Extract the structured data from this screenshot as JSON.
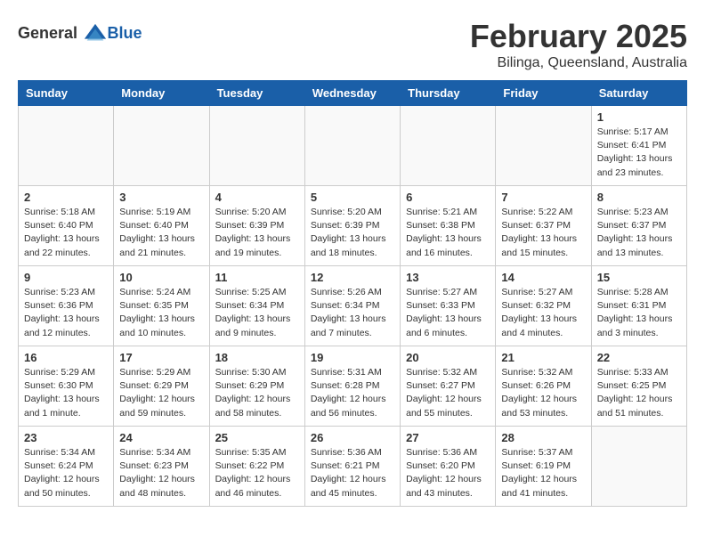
{
  "header": {
    "logo_general": "General",
    "logo_blue": "Blue",
    "month_year": "February 2025",
    "location": "Bilinga, Queensland, Australia"
  },
  "weekdays": [
    "Sunday",
    "Monday",
    "Tuesday",
    "Wednesday",
    "Thursday",
    "Friday",
    "Saturday"
  ],
  "weeks": [
    [
      {
        "day": "",
        "info": ""
      },
      {
        "day": "",
        "info": ""
      },
      {
        "day": "",
        "info": ""
      },
      {
        "day": "",
        "info": ""
      },
      {
        "day": "",
        "info": ""
      },
      {
        "day": "",
        "info": ""
      },
      {
        "day": "1",
        "info": "Sunrise: 5:17 AM\nSunset: 6:41 PM\nDaylight: 13 hours\nand 23 minutes."
      }
    ],
    [
      {
        "day": "2",
        "info": "Sunrise: 5:18 AM\nSunset: 6:40 PM\nDaylight: 13 hours\nand 22 minutes."
      },
      {
        "day": "3",
        "info": "Sunrise: 5:19 AM\nSunset: 6:40 PM\nDaylight: 13 hours\nand 21 minutes."
      },
      {
        "day": "4",
        "info": "Sunrise: 5:20 AM\nSunset: 6:39 PM\nDaylight: 13 hours\nand 19 minutes."
      },
      {
        "day": "5",
        "info": "Sunrise: 5:20 AM\nSunset: 6:39 PM\nDaylight: 13 hours\nand 18 minutes."
      },
      {
        "day": "6",
        "info": "Sunrise: 5:21 AM\nSunset: 6:38 PM\nDaylight: 13 hours\nand 16 minutes."
      },
      {
        "day": "7",
        "info": "Sunrise: 5:22 AM\nSunset: 6:37 PM\nDaylight: 13 hours\nand 15 minutes."
      },
      {
        "day": "8",
        "info": "Sunrise: 5:23 AM\nSunset: 6:37 PM\nDaylight: 13 hours\nand 13 minutes."
      }
    ],
    [
      {
        "day": "9",
        "info": "Sunrise: 5:23 AM\nSunset: 6:36 PM\nDaylight: 13 hours\nand 12 minutes."
      },
      {
        "day": "10",
        "info": "Sunrise: 5:24 AM\nSunset: 6:35 PM\nDaylight: 13 hours\nand 10 minutes."
      },
      {
        "day": "11",
        "info": "Sunrise: 5:25 AM\nSunset: 6:34 PM\nDaylight: 13 hours\nand 9 minutes."
      },
      {
        "day": "12",
        "info": "Sunrise: 5:26 AM\nSunset: 6:34 PM\nDaylight: 13 hours\nand 7 minutes."
      },
      {
        "day": "13",
        "info": "Sunrise: 5:27 AM\nSunset: 6:33 PM\nDaylight: 13 hours\nand 6 minutes."
      },
      {
        "day": "14",
        "info": "Sunrise: 5:27 AM\nSunset: 6:32 PM\nDaylight: 13 hours\nand 4 minutes."
      },
      {
        "day": "15",
        "info": "Sunrise: 5:28 AM\nSunset: 6:31 PM\nDaylight: 13 hours\nand 3 minutes."
      }
    ],
    [
      {
        "day": "16",
        "info": "Sunrise: 5:29 AM\nSunset: 6:30 PM\nDaylight: 13 hours\nand 1 minute."
      },
      {
        "day": "17",
        "info": "Sunrise: 5:29 AM\nSunset: 6:29 PM\nDaylight: 12 hours\nand 59 minutes."
      },
      {
        "day": "18",
        "info": "Sunrise: 5:30 AM\nSunset: 6:29 PM\nDaylight: 12 hours\nand 58 minutes."
      },
      {
        "day": "19",
        "info": "Sunrise: 5:31 AM\nSunset: 6:28 PM\nDaylight: 12 hours\nand 56 minutes."
      },
      {
        "day": "20",
        "info": "Sunrise: 5:32 AM\nSunset: 6:27 PM\nDaylight: 12 hours\nand 55 minutes."
      },
      {
        "day": "21",
        "info": "Sunrise: 5:32 AM\nSunset: 6:26 PM\nDaylight: 12 hours\nand 53 minutes."
      },
      {
        "day": "22",
        "info": "Sunrise: 5:33 AM\nSunset: 6:25 PM\nDaylight: 12 hours\nand 51 minutes."
      }
    ],
    [
      {
        "day": "23",
        "info": "Sunrise: 5:34 AM\nSunset: 6:24 PM\nDaylight: 12 hours\nand 50 minutes."
      },
      {
        "day": "24",
        "info": "Sunrise: 5:34 AM\nSunset: 6:23 PM\nDaylight: 12 hours\nand 48 minutes."
      },
      {
        "day": "25",
        "info": "Sunrise: 5:35 AM\nSunset: 6:22 PM\nDaylight: 12 hours\nand 46 minutes."
      },
      {
        "day": "26",
        "info": "Sunrise: 5:36 AM\nSunset: 6:21 PM\nDaylight: 12 hours\nand 45 minutes."
      },
      {
        "day": "27",
        "info": "Sunrise: 5:36 AM\nSunset: 6:20 PM\nDaylight: 12 hours\nand 43 minutes."
      },
      {
        "day": "28",
        "info": "Sunrise: 5:37 AM\nSunset: 6:19 PM\nDaylight: 12 hours\nand 41 minutes."
      },
      {
        "day": "",
        "info": ""
      }
    ]
  ]
}
